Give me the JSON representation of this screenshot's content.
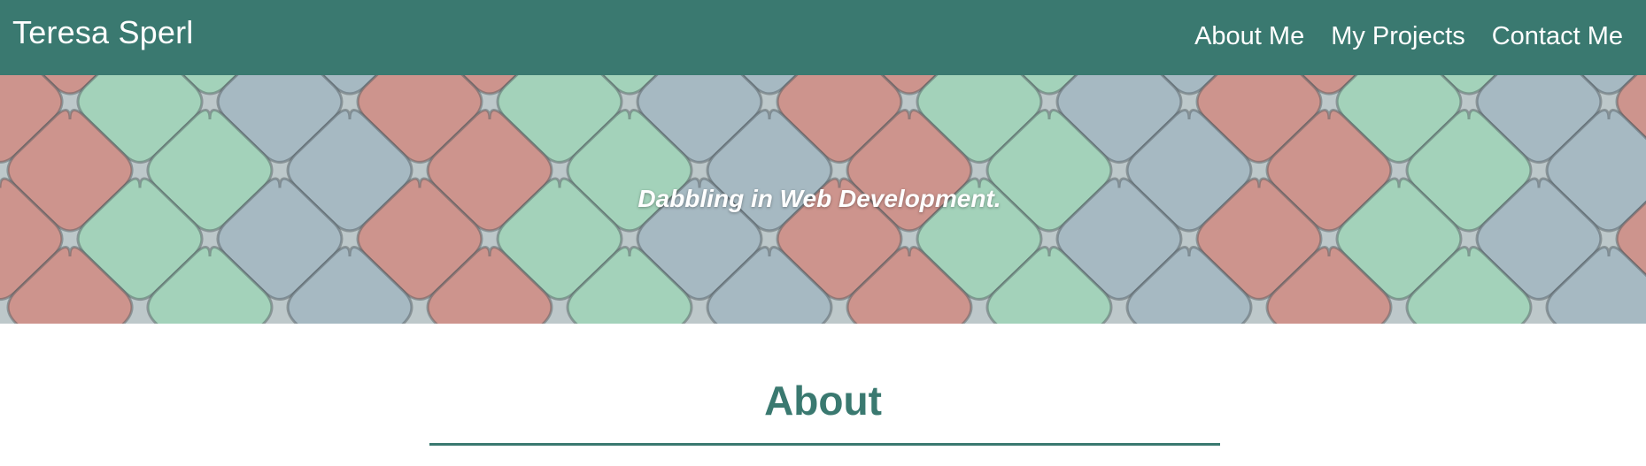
{
  "header": {
    "brand": "Teresa Sperl",
    "nav": [
      {
        "label": "About Me"
      },
      {
        "label": "My Projects"
      },
      {
        "label": "Contact Me"
      }
    ],
    "background_color": "#3a7970"
  },
  "hero": {
    "tagline": "Dabbling in Web Development.",
    "background_image": "colorful-diamond-tiles-photo"
  },
  "about": {
    "heading": "About",
    "accent_color": "#3a7970"
  }
}
